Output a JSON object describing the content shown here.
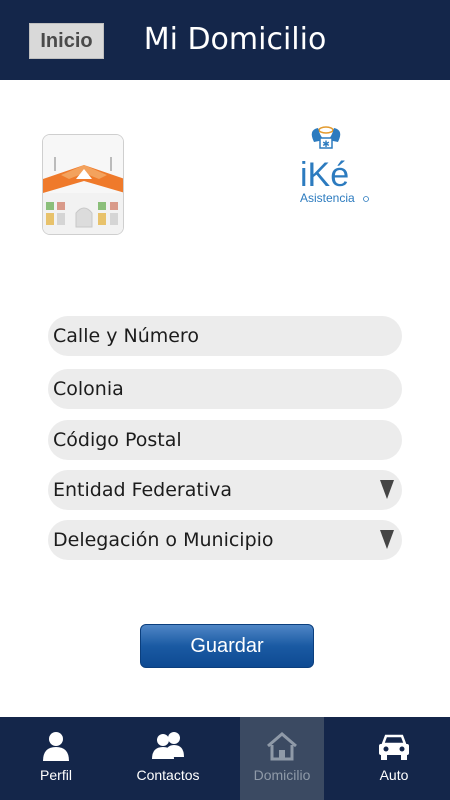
{
  "header": {
    "back_label": "Inicio",
    "title": "Mi Domicilio"
  },
  "logo": {
    "brand": "iKé",
    "subtitle": "Asistencia"
  },
  "form": {
    "fields": [
      {
        "placeholder": "Calle y Número"
      },
      {
        "placeholder": "Colonia"
      },
      {
        "placeholder": "Código Postal"
      }
    ],
    "selects": [
      {
        "value": "Entidad Federativa"
      },
      {
        "value": "Delegación o Municipio"
      }
    ],
    "save_label": "Guardar"
  },
  "tabbar": {
    "items": [
      {
        "label": "Perfil",
        "icon": "person-icon"
      },
      {
        "label": "Contactos",
        "icon": "people-icon"
      },
      {
        "label": "Domicilio",
        "icon": "home-icon",
        "active": true
      },
      {
        "label": "Auto",
        "icon": "car-icon"
      }
    ]
  },
  "colors": {
    "header": "#14264a",
    "accent": "#1a5aa3",
    "field": "#ececec"
  }
}
